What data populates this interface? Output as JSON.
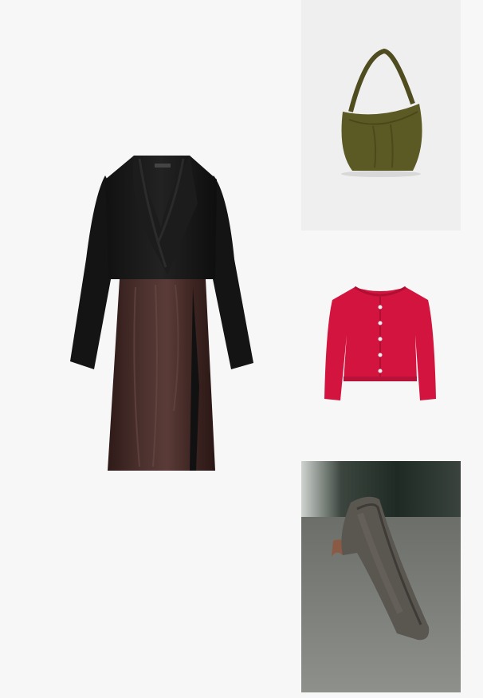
{
  "collage": {
    "items": [
      {
        "id": "dress",
        "icon": "dress-icon",
        "color": "#3d2624"
      },
      {
        "id": "bag",
        "icon": "bag-icon",
        "color": "#5c5a24"
      },
      {
        "id": "cardigan",
        "icon": "cardigan-icon",
        "color": "#d2143e"
      },
      {
        "id": "shoe",
        "icon": "shoe-icon",
        "color": "#5a5650"
      }
    ]
  }
}
